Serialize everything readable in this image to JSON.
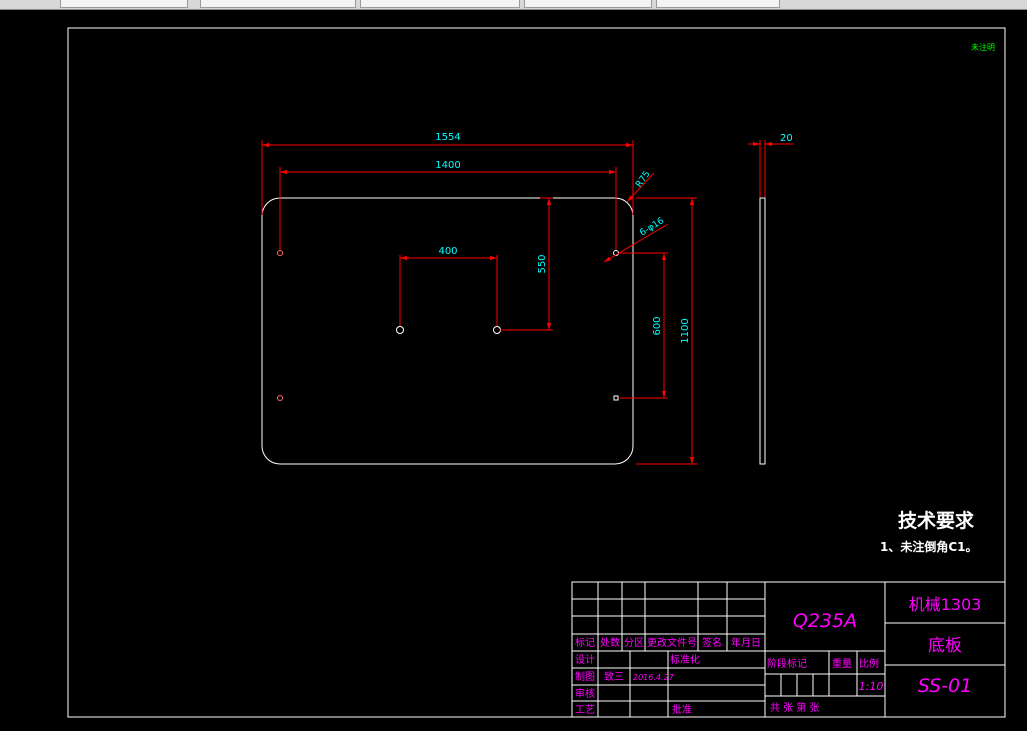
{
  "tabs": [
    {
      "label": "",
      "active": false
    },
    {
      "label": "",
      "active": false
    },
    {
      "label": "",
      "active": false
    },
    {
      "label": "",
      "active": false
    },
    {
      "label": "",
      "active": false
    }
  ],
  "corner_note": "未注明",
  "dimensions": {
    "overall_width": "1554",
    "hole_spacing_x": "1400",
    "corner_radius": "R75",
    "holes": "6-φ16",
    "inner_spacing_x": "400",
    "inner_spacing_y": "550",
    "hole_spacing_y": "600",
    "overall_height": "1100",
    "thickness": "20"
  },
  "tech_requirements": {
    "title": "技术要求",
    "item1": "1、未注倒角C1。"
  },
  "title_block": {
    "material": "Q235A",
    "class_name": "机械1303",
    "part_name": "底板",
    "drawing_no": "SS-01",
    "scale": "1:10",
    "headers": {
      "mark": "标记",
      "count": "处数",
      "zone": "分区",
      "change_doc": "更改文件号",
      "signature": "签名",
      "date": "年月日",
      "design": "设计",
      "standardize": "标准化",
      "draw": "制图",
      "check": "审核",
      "process": "工艺",
      "approve": "批准",
      "stage_mark": "阶段标记",
      "weight": "重量",
      "ratio": "比例",
      "total_sheets": "共   张  第   张"
    },
    "drawer_name": "致三",
    "draw_date": "2016.4.27"
  },
  "colors": {
    "background": "#000000",
    "geometry": "#ffffff",
    "dimension_line": "#ff0000",
    "dimension_text": "#00ffff",
    "title_magenta": "#ff00ff",
    "note_green": "#00ff00"
  }
}
